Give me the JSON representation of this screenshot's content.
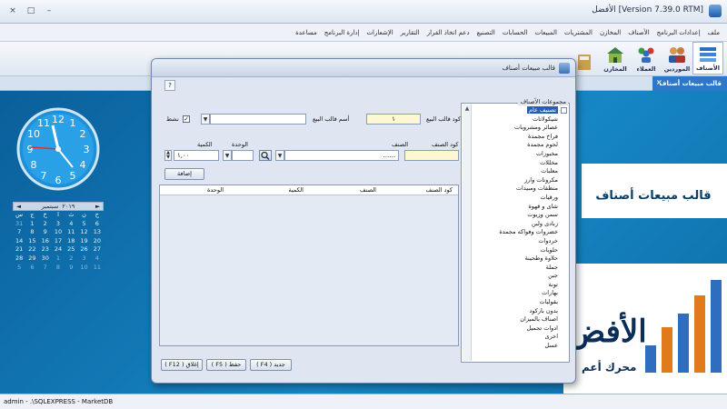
{
  "window": {
    "title": "[Version 7.39.0 RTM] الأفضل",
    "controls": [
      "×",
      "□",
      "–"
    ]
  },
  "menu": [
    "ملف",
    "إعدادات البرنامج",
    "الأصناف",
    "المخازن",
    "المشتريات",
    "المبيعات",
    "الحسابات",
    "التصنيع",
    "دعم اتخاذ القرار",
    "التقارير",
    "الإشعارات",
    "إدارة البرنامج",
    "مساعدة"
  ],
  "ribbon": {
    "buttons": [
      {
        "label": "الأصناف",
        "icon": "items-icon"
      },
      {
        "label": "الموردين",
        "icon": "suppliers-icon"
      },
      {
        "label": "العملاء",
        "icon": "customers-icon"
      },
      {
        "label": "المخازن",
        "icon": "stores-icon"
      },
      {
        "label": "",
        "icon": "calculator-icon"
      },
      {
        "label": "",
        "icon": "coins-icon"
      }
    ],
    "right_tools": [
      "help-icon",
      "chart-icon",
      "documents-icon",
      "scale-icon",
      "archive-icon",
      "money-icon"
    ]
  },
  "tab": {
    "label": "قالب مبيعات أصناف",
    "close": "×"
  },
  "desktop": {
    "banner": "قالب مبيعات أصناف",
    "logo": "الأفض",
    "logo_sub": "محرك أعم"
  },
  "calendar": {
    "month": "سبتمبر",
    "year": "٢٠١٩",
    "prev": "◄",
    "next": "►",
    "weekdays": [
      "س",
      "ج",
      "خ",
      "ا",
      "ث",
      "ن",
      "ح"
    ],
    "days": [
      {
        "d": "31",
        "dim": true
      },
      {
        "d": "1"
      },
      {
        "d": "2"
      },
      {
        "d": "3"
      },
      {
        "d": "4"
      },
      {
        "d": "5"
      },
      {
        "d": "6"
      },
      {
        "d": "7"
      },
      {
        "d": "8"
      },
      {
        "d": "9"
      },
      {
        "d": "10"
      },
      {
        "d": "11"
      },
      {
        "d": "12"
      },
      {
        "d": "13"
      },
      {
        "d": "14"
      },
      {
        "d": "15"
      },
      {
        "d": "16"
      },
      {
        "d": "17"
      },
      {
        "d": "18"
      },
      {
        "d": "19"
      },
      {
        "d": "20"
      },
      {
        "d": "21"
      },
      {
        "d": "22"
      },
      {
        "d": "23"
      },
      {
        "d": "24"
      },
      {
        "d": "25"
      },
      {
        "d": "26"
      },
      {
        "d": "27"
      },
      {
        "d": "28"
      },
      {
        "d": "29"
      },
      {
        "d": "30"
      },
      {
        "d": "1",
        "dim": true
      },
      {
        "d": "2",
        "dim": true
      },
      {
        "d": "3",
        "dim": true
      },
      {
        "d": "4",
        "dim": true
      },
      {
        "d": "5",
        "dim": true
      },
      {
        "d": "6",
        "dim": true
      },
      {
        "d": "7",
        "dim": true
      },
      {
        "d": "8",
        "dim": true
      },
      {
        "d": "9",
        "dim": true
      },
      {
        "d": "10",
        "dim": true
      },
      {
        "d": "11",
        "dim": true
      }
    ]
  },
  "status": {
    "text": "admin  -  .\\SQLEXPRESS  -  MarketDB"
  },
  "dialog": {
    "title": "قالب مبيعات أصناف",
    "help": "?",
    "group_label": "مجموعات الأصناف",
    "tree_items": [
      {
        "label": "تصنيف عام",
        "sel": true
      },
      {
        "label": "شيكولاتات"
      },
      {
        "label": "عصائر ومشروبات"
      },
      {
        "label": "فراخ مجمدة"
      },
      {
        "label": "لحوم مجمدة"
      },
      {
        "label": "مخبوزات"
      },
      {
        "label": "مخللات"
      },
      {
        "label": "معلبات"
      },
      {
        "label": "مكرونات وارز"
      },
      {
        "label": "منظفات ومبيدات"
      },
      {
        "label": "ورقيات"
      },
      {
        "label": "شاى و قهوة"
      },
      {
        "label": "سمن وزيوت"
      },
      {
        "label": "زبادى ولبن"
      },
      {
        "label": "خضروات وفواكه مجمدة"
      },
      {
        "label": "خردوات"
      },
      {
        "label": "حلويات"
      },
      {
        "label": "حلاوة وطحينة"
      },
      {
        "label": "جملة"
      },
      {
        "label": "جبن"
      },
      {
        "label": "تونة"
      },
      {
        "label": "بهارات"
      },
      {
        "label": "بقوليات"
      },
      {
        "label": "بدون باركود"
      },
      {
        "label": "اصناف بالميزان"
      },
      {
        "label": "ادوات تجميل"
      },
      {
        "label": "اخرى"
      },
      {
        "label": "عسل"
      }
    ],
    "fields": {
      "template_code_label": "كود قالب البيع",
      "template_code_value": "١",
      "template_name_label": "أسم قالب البيع",
      "template_name_value": "",
      "active_label": "نشط",
      "active_mark": "✓",
      "item_code_label": "كود الصنف",
      "item_label": "الصنف",
      "item_value": "......",
      "unit_label": "الوحدة",
      "qty_label": "الكمية",
      "qty_value": "١,٠٠",
      "add_button": "إضافة"
    },
    "grid_columns": [
      "كود الصنف",
      "الصنف",
      "الكمية",
      "الوحدة"
    ],
    "buttons": {
      "new": "جديد ( F4 )",
      "save": "حفظ ( F5 )",
      "close": "إغلاق ( F12 )"
    }
  }
}
